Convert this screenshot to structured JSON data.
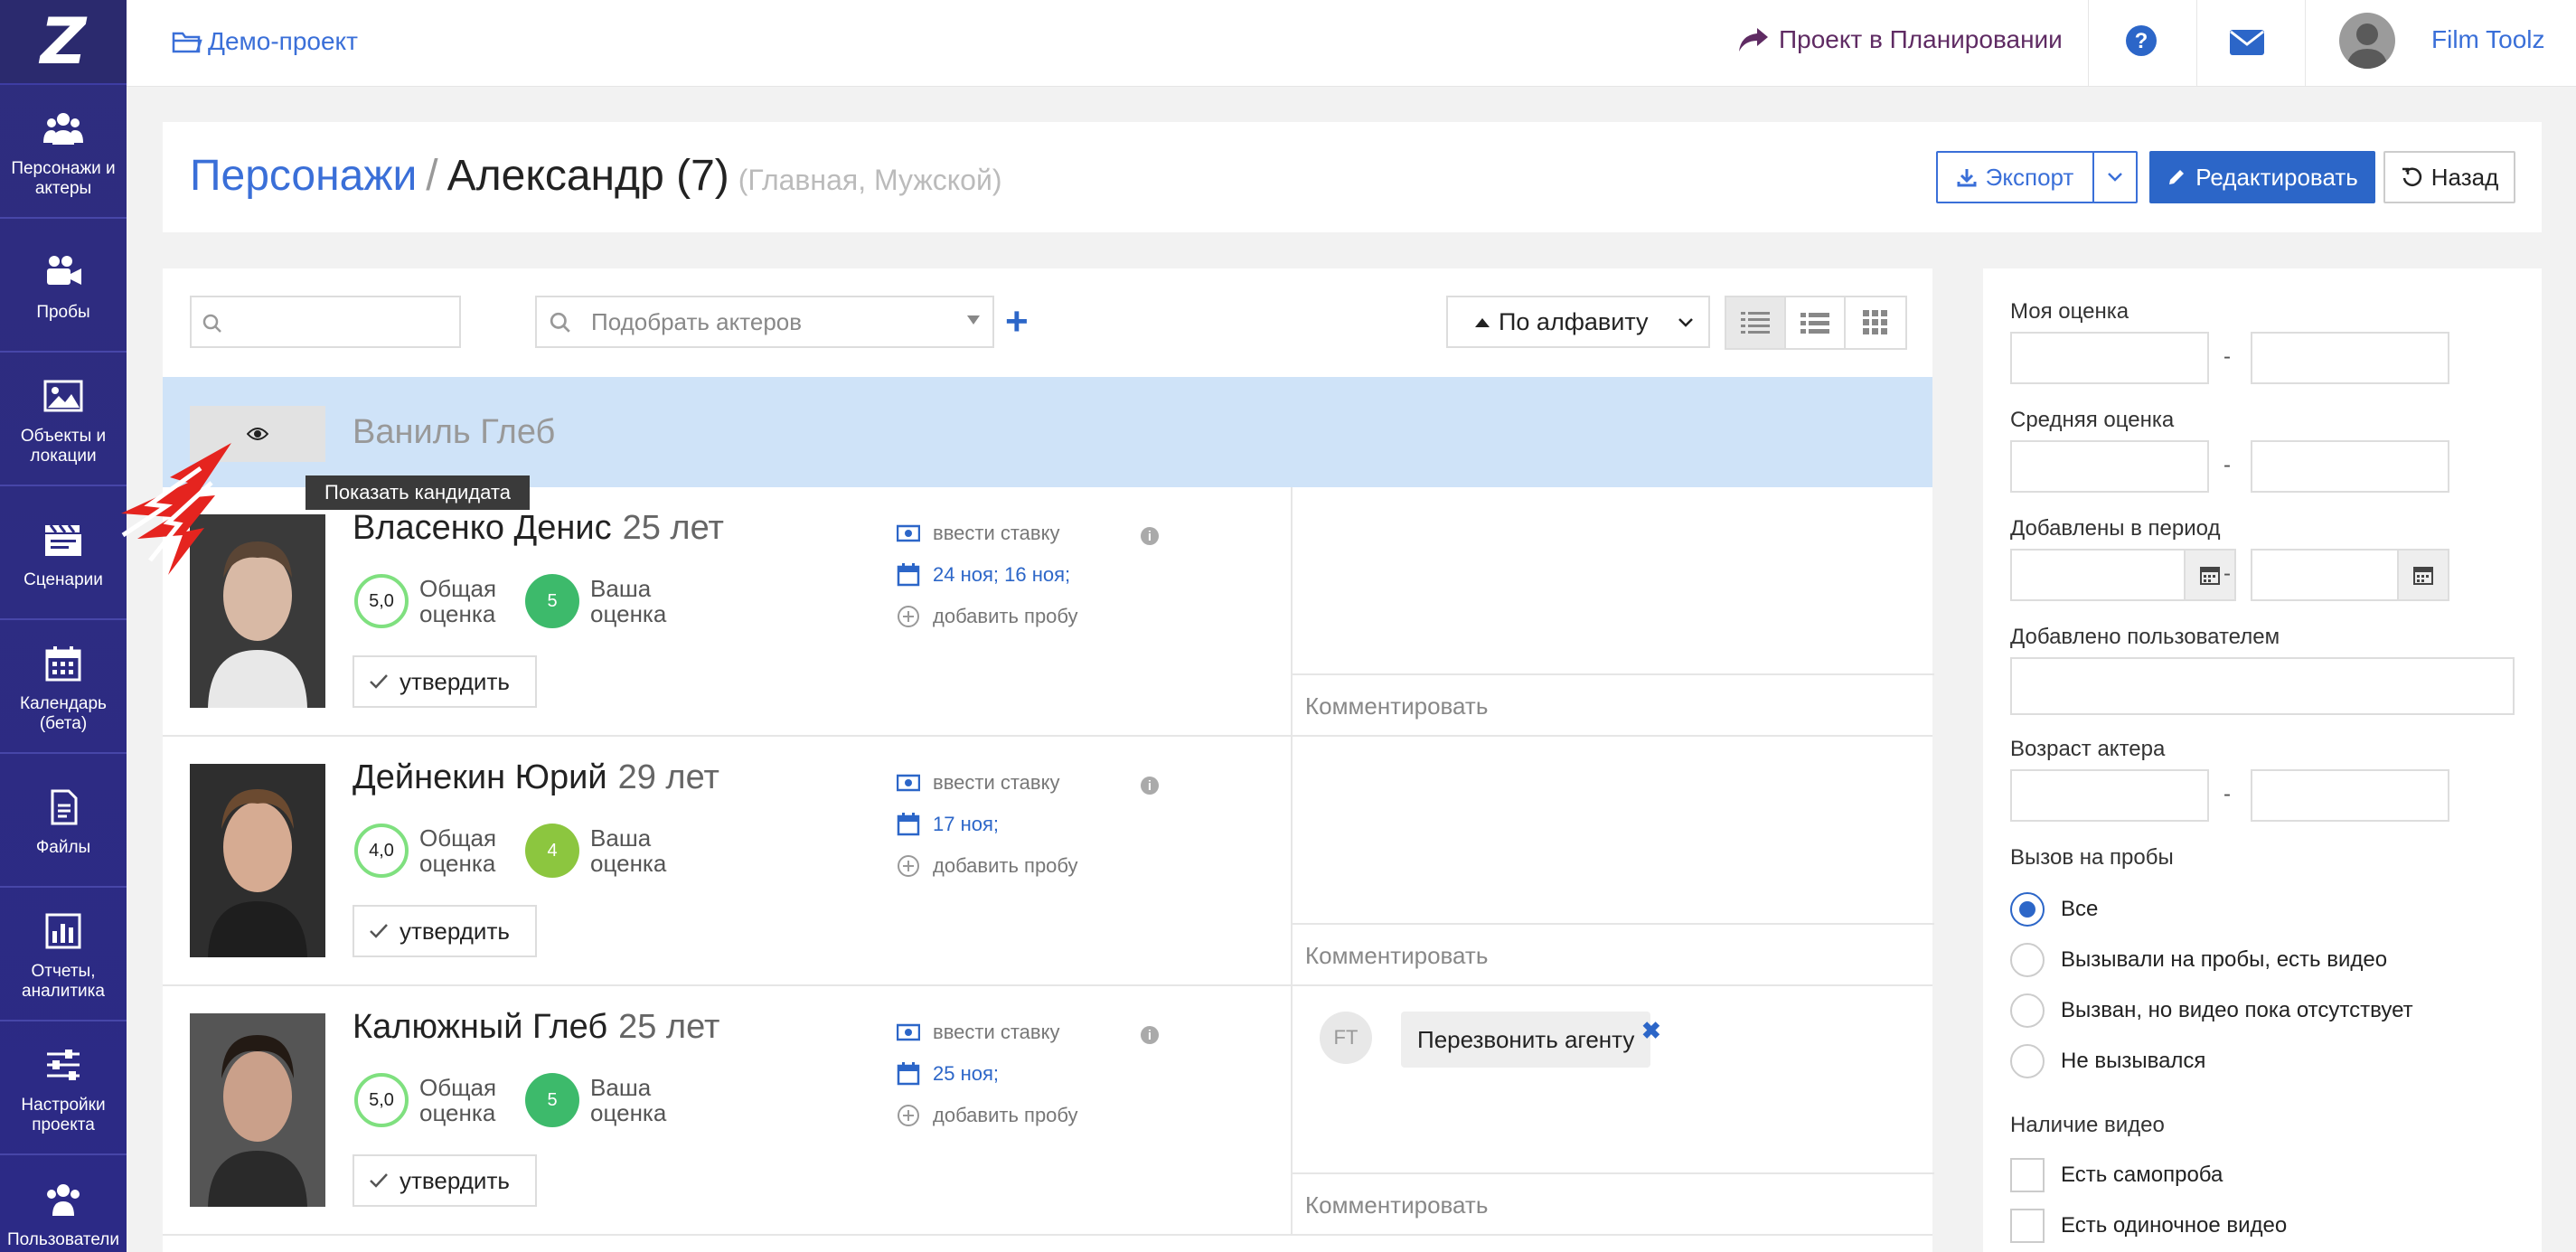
{
  "sidebar": {
    "logo": "Z",
    "items": [
      {
        "label": "Персонажи и актеры",
        "icon": "users-icon"
      },
      {
        "label": "Пробы",
        "icon": "video-camera-icon"
      },
      {
        "label": "Объекты и локации",
        "icon": "image-icon"
      },
      {
        "label": "Сценарии",
        "icon": "clapperboard-icon"
      },
      {
        "label": "Календарь (бета)",
        "icon": "calendar-icon"
      },
      {
        "label": "Файлы",
        "icon": "file-icon"
      },
      {
        "label": "Отчеты, аналитика",
        "icon": "chart-icon"
      },
      {
        "label": "Настройки проекта",
        "icon": "sliders-icon"
      },
      {
        "label": "Пользователи и",
        "icon": "users-icon"
      }
    ]
  },
  "topbar": {
    "project": "Демо-проект",
    "planning": "Проект в Планировании",
    "user": "Film Toolz"
  },
  "header": {
    "crumb_link": "Персонажи",
    "crumb_sep": "/",
    "crumb_current": "Александр (7)",
    "crumb_sub": "(Главная, Мужской)",
    "export_label": "Экспорт",
    "edit_label": "Редактировать",
    "back_label": "Назад"
  },
  "toolbar": {
    "pick_placeholder": "Подобрать актеров",
    "plus": "+",
    "sort_label": "По алфавиту"
  },
  "hidden_candidate": {
    "name": "Ваниль Глеб",
    "tooltip": "Показать кандидата"
  },
  "candidates": [
    {
      "name": "Власенко Денис",
      "age": "25 лет",
      "total_score": "5,0",
      "total_label_1": "Общая",
      "total_label_2": "оценка",
      "your_score": "5",
      "your_label_1": "Ваша",
      "your_label_2": "оценка",
      "your_color": "#3dba6b",
      "approve": "утвердить",
      "rate": "ввести ставку",
      "dates": "24 ноя; 16 ноя;",
      "add_trial": "добавить пробу",
      "comment": "Комментировать"
    },
    {
      "name": "Дейнекин Юрий",
      "age": "29 лет",
      "total_score": "4,0",
      "total_label_1": "Общая",
      "total_label_2": "оценка",
      "your_score": "4",
      "your_label_1": "Ваша",
      "your_label_2": "оценка",
      "your_color": "#8cc63f",
      "approve": "утвердить",
      "rate": "ввести ставку",
      "dates": "17 ноя;",
      "add_trial": "добавить пробу",
      "comment": "Комментировать"
    },
    {
      "name": "Калюжный Глеб",
      "age": "25 лет",
      "total_score": "5,0",
      "total_label_1": "Общая",
      "total_label_2": "оценка",
      "your_score": "5",
      "your_label_1": "Ваша",
      "your_label_2": "оценка",
      "your_color": "#3dba6b",
      "approve": "утвердить",
      "rate": "ввести ставку",
      "dates": "25 ноя;",
      "add_trial": "добавить пробу",
      "comment": "Комментировать",
      "note_author": "FT",
      "note_text": "Перезвонить агенту",
      "note_close": "✖"
    }
  ],
  "filters": {
    "my_rating": "Моя оценка",
    "avg_rating": "Средняя оценка",
    "added_period": "Добавлены в период",
    "added_by_user": "Добавлено пользователем",
    "actor_age": "Возраст актера",
    "dash": "-",
    "trial_call": "Вызов на пробы",
    "trial_options": [
      "Все",
      "Вызывали на пробы, есть видео",
      "Вызван, но видео пока отсутствует",
      "Не вызывался"
    ],
    "video_presence": "Наличие видео",
    "video_options": [
      "Есть самопроба",
      "Есть одиночное видео"
    ]
  },
  "colors": {
    "sidebar": "#2c2a86",
    "accent": "#2c66c8",
    "link": "#3a6fd8",
    "hidden_row": "#cfe3f8"
  }
}
